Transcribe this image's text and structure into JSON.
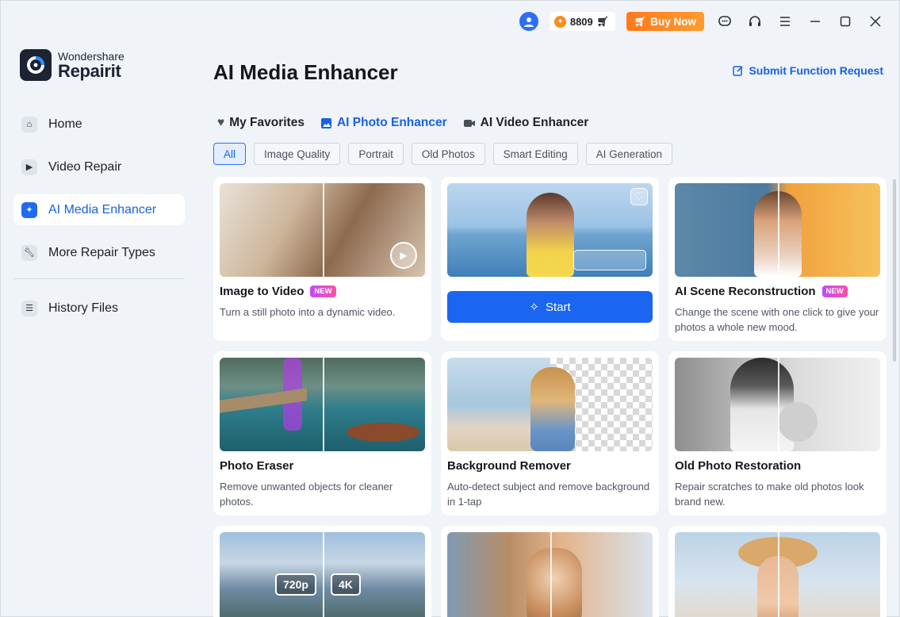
{
  "titlebar": {
    "credits": "8809",
    "buy_now": "Buy Now"
  },
  "brand": {
    "line1": "Wondershare",
    "line2": "Repairit"
  },
  "sidebar": {
    "items": [
      {
        "label": "Home",
        "icon": "home-icon"
      },
      {
        "label": "Video Repair",
        "icon": "play-icon"
      },
      {
        "label": "AI Media Enhancer",
        "icon": "sparkle-icon",
        "active": true
      },
      {
        "label": "More Repair Types",
        "icon": "wrench-icon"
      },
      {
        "label": "History Files",
        "icon": "list-icon"
      }
    ]
  },
  "main": {
    "title": "AI Media Enhancer",
    "submit_request": "Submit Function Request",
    "tabs": [
      {
        "label": "My Favorites",
        "icon": "heart-icon"
      },
      {
        "label": "AI Photo Enhancer",
        "icon": "image-icon",
        "active": true
      },
      {
        "label": "AI Video Enhancer",
        "icon": "video-icon"
      }
    ],
    "filters": [
      "All",
      "Image Quality",
      "Portrait",
      "Old Photos",
      "Smart Editing",
      "AI Generation"
    ],
    "start_label": "Start",
    "cards": [
      {
        "title": "Image to Video",
        "badge": "NEW",
        "desc": "Turn a still photo into a dynamic video."
      },
      {
        "title": "AI Scene Reconstruction",
        "badge": "NEW",
        "desc": "Change the scene with one click to give your photos a whole new mood."
      },
      {
        "title": "Photo Eraser",
        "desc": "Remove unwanted objects for cleaner photos."
      },
      {
        "title": "Background Remover",
        "desc": "Auto-detect subject and remove background in 1-tap"
      },
      {
        "title": "Old Photo Restoration",
        "desc": "Repair scratches to make old photos look brand new."
      }
    ],
    "res_tags": [
      "720p",
      "4K"
    ]
  },
  "colors": {
    "accent": "#1a66f0",
    "buy": "#ff8a1e",
    "badge": "#d04cf5"
  }
}
